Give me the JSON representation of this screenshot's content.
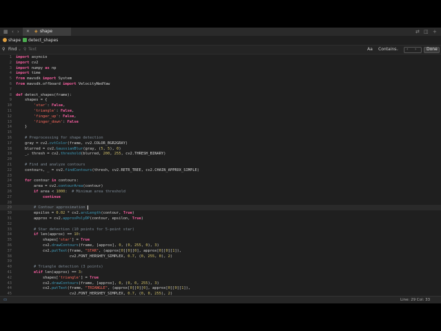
{
  "tab": {
    "title": "shape"
  },
  "breadcrumb": {
    "project": "shape",
    "file": "detect_shapes"
  },
  "find": {
    "mode": "Find",
    "placeholder": "Text",
    "aa": "Aa",
    "match_mode": "Contains",
    "done": "Done"
  },
  "status": {
    "position": "Line: 29  Col: 33"
  },
  "icons": [
    "sidebar-icon",
    "back-icon",
    "forward-icon",
    "close-icon",
    "swap-icon",
    "split-icon",
    "add-icon",
    "find-icon",
    "prev-icon",
    "next-icon"
  ],
  "colors": {
    "keyword": "#fc5fa3",
    "string": "#fc6a5d",
    "number": "#d0bf69",
    "comment": "#7f8c98",
    "func": "#41a1c0"
  },
  "code": {
    "current_line": 29,
    "lines": [
      "import asyncio",
      "import cv2",
      "import numpy as np",
      "import time",
      "from mavsdk import System",
      "from mavsdk.offboard import VelocityNedYaw",
      "",
      "def detect_shapes(frame):",
      "    shapes = {",
      "        'star': False,",
      "        'triangle': False,",
      "        'finger_up': False,",
      "        'finger_down': False",
      "    }",
      "",
      "    # Preprocessing for shape detection",
      "    gray = cv2.cvtColor(frame, cv2.COLOR_BGR2GRAY)",
      "    blurred = cv2.GaussianBlur(gray, (5, 5), 0)",
      "    _, thresh = cv2.threshold(blurred, 200, 255, cv2.THRESH_BINARY)",
      "",
      "    # Find and analyze contours",
      "    contours, _ = cv2.findContours(thresh, cv2.RETR_TREE, cv2.CHAIN_APPROX_SIMPLE)",
      "",
      "    for contour in contours:",
      "        area = cv2.contourArea(contour)",
      "        if area < 1000:  # Minimum area threshold",
      "            continue",
      "",
      "        # Contour approximation ",
      "        epsilon = 0.02 * cv2.arcLength(contour, True)",
      "        approx = cv2.approxPolyDP(contour, epsilon, True)",
      "",
      "        # Star detection (10 points for 5-point star)",
      "        if len(approx) == 10:",
      "            shapes['star'] = True",
      "            cv2.drawContours(frame, [approx], 0, (0, 255, 0), 3)",
      "            cv2.putText(frame, \"STAR\", (approx[0][0][0], approx[0][0][1]),",
      "                        cv2.FONT_HERSHEY_SIMPLEX, 0.7, (0, 255, 0), 2)",
      "",
      "        # Triangle detection (3 points)",
      "        elif len(approx) == 3:",
      "            shapes['triangle'] = True",
      "            cv2.drawContours(frame, [approx], 0, (0, 0, 255), 3)",
      "            cv2.putText(frame, \"TRIANGLE\", (approx[0][0][0], approx[0][0][1]),",
      "                        cv2.FONT_HERSHEY_SIMPLEX, 0.7, (0, 0, 255), 2)"
    ]
  }
}
